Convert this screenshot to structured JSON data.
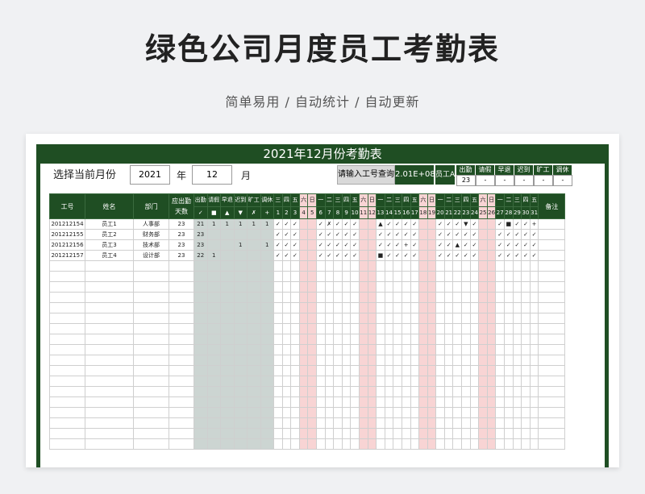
{
  "hero": {
    "title": "绿色公司月度员工考勤表",
    "subtitle": "简单易用 / 自动统计 / 自动更新"
  },
  "sheet": {
    "title": "2021年12月份考勤表",
    "month_label": "选择当前月份",
    "year_value": "2021",
    "year_unit": "年",
    "month_value": "12",
    "month_unit": "月",
    "query_button": "请输入工号查询",
    "query_value": "2.01E+08",
    "query_name_label": "员工A",
    "summary_headers": [
      "出勤",
      "请假",
      "早退",
      "迟到",
      "旷工",
      "调休"
    ],
    "summary_values": [
      "23",
      "-",
      "-",
      "-",
      "-",
      "-"
    ]
  },
  "table": {
    "col_headers": {
      "id": "工号",
      "name": "姓名",
      "dept": "部门",
      "due": "应出勤天数",
      "note": "备注"
    },
    "stat_headers": [
      "出勤",
      "请假",
      "早退",
      "迟到",
      "旷工",
      "调休"
    ],
    "stat_symbols": [
      "✓",
      "■",
      "▲",
      "▼",
      "✗",
      "+"
    ],
    "weekdays": [
      "三",
      "四",
      "五",
      "六",
      "日",
      "一",
      "二",
      "三",
      "四",
      "五",
      "六",
      "日",
      "一",
      "二",
      "三",
      "四",
      "五",
      "六",
      "日",
      "一",
      "二",
      "三",
      "四",
      "五",
      "六",
      "日",
      "一",
      "二",
      "三",
      "四",
      "五"
    ],
    "weekend_idx": [
      3,
      4,
      10,
      11,
      17,
      18,
      24,
      25
    ],
    "days": [
      "1",
      "2",
      "3",
      "4",
      "5",
      "6",
      "7",
      "8",
      "9",
      "10",
      "11",
      "12",
      "13",
      "14",
      "15",
      "16",
      "17",
      "18",
      "19",
      "20",
      "21",
      "22",
      "23",
      "24",
      "25",
      "26",
      "27",
      "28",
      "29",
      "30",
      "31"
    ],
    "rows": [
      {
        "id": "201212154",
        "name": "员工1",
        "dept": "人事部",
        "due": "23",
        "stats": [
          "21",
          "1",
          "1",
          "1",
          "1",
          "1"
        ],
        "marks": [
          "✓",
          "✓",
          "✓",
          "",
          "",
          "✓",
          "✗",
          "✓",
          "✓",
          "✓",
          "",
          "",
          "▲",
          "✓",
          "✓",
          "✓",
          "✓",
          "",
          "",
          "✓",
          "✓",
          "✓",
          "▼",
          "✓",
          "",
          "",
          "✓",
          "■",
          "✓",
          "✓",
          "+"
        ]
      },
      {
        "id": "201212155",
        "name": "员工2",
        "dept": "财务部",
        "due": "23",
        "stats": [
          "23",
          "",
          "",
          "",
          "",
          ""
        ],
        "marks": [
          "✓",
          "✓",
          "✓",
          "",
          "",
          "✓",
          "✓",
          "✓",
          "✓",
          "✓",
          "",
          "",
          "✓",
          "✓",
          "✓",
          "✓",
          "✓",
          "",
          "",
          "✓",
          "✓",
          "✓",
          "✓",
          "✓",
          "",
          "",
          "✓",
          "✓",
          "✓",
          "✓",
          "✓"
        ]
      },
      {
        "id": "201212156",
        "name": "员工3",
        "dept": "技术部",
        "due": "23",
        "stats": [
          "23",
          "",
          "",
          "1",
          "",
          "1"
        ],
        "marks": [
          "✓",
          "✓",
          "✓",
          "",
          "",
          "✓",
          "✓",
          "✓",
          "✓",
          "✓",
          "",
          "",
          "✓",
          "✓",
          "✓",
          "+",
          "✓",
          "",
          "",
          "✓",
          "✓",
          "▲",
          "✓",
          "✓",
          "",
          "",
          "✓",
          "✓",
          "✓",
          "✓",
          "✓"
        ]
      },
      {
        "id": "201212157",
        "name": "员工4",
        "dept": "设计部",
        "due": "23",
        "stats": [
          "22",
          "1",
          "",
          "",
          "",
          ""
        ],
        "marks": [
          "✓",
          "✓",
          "✓",
          "",
          "",
          "✓",
          "✓",
          "✓",
          "✓",
          "✓",
          "",
          "",
          "■",
          "✓",
          "✓",
          "✓",
          "✓",
          "",
          "",
          "✓",
          "✓",
          "✓",
          "✓",
          "✓",
          "",
          "",
          "✓",
          "✓",
          "✓",
          "✓",
          "✓"
        ]
      }
    ],
    "empty_rows": 18
  }
}
